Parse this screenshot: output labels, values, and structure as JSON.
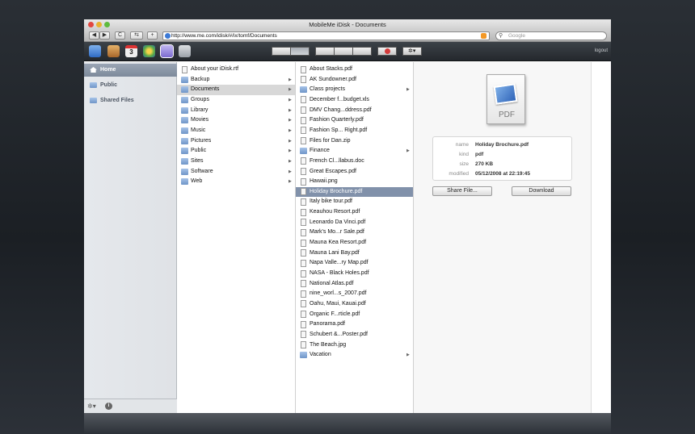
{
  "window": {
    "title": "MobileMe iDisk - Documents"
  },
  "toolbar": {
    "back": "◀",
    "forward": "▶",
    "reload": "C",
    "bookmarks": "⇆",
    "add": "+",
    "url": "http://www.me.com/idisk/#/ix/tomf/Documents",
    "search_placeholder": "Google"
  },
  "appbar": {
    "apps": [
      {
        "name": "mail",
        "color": "#4a86d8"
      },
      {
        "name": "contacts",
        "color": "#c88a3a"
      },
      {
        "name": "calendar",
        "color": "#d9d9d9",
        "label": "3"
      },
      {
        "name": "gallery",
        "color": "#6cae4e"
      },
      {
        "name": "idisk",
        "color": "#8f7fd6"
      },
      {
        "name": "account",
        "color": "#9aa0a7"
      }
    ],
    "logout": "logout"
  },
  "sidebar": {
    "items": [
      {
        "label": "Home",
        "selected": true
      },
      {
        "label": "Public",
        "selected": false
      },
      {
        "label": "Shared Files",
        "selected": false
      }
    ]
  },
  "column1": {
    "items": [
      {
        "label": "About your iDisk.rtf",
        "type": "doc"
      },
      {
        "label": "Backup",
        "type": "folder"
      },
      {
        "label": "Documents",
        "type": "folder",
        "selected": true
      },
      {
        "label": "Groups",
        "type": "folder"
      },
      {
        "label": "Library",
        "type": "folder"
      },
      {
        "label": "Movies",
        "type": "folder"
      },
      {
        "label": "Music",
        "type": "folder"
      },
      {
        "label": "Pictures",
        "type": "folder"
      },
      {
        "label": "Public",
        "type": "folder"
      },
      {
        "label": "Sites",
        "type": "folder"
      },
      {
        "label": "Software",
        "type": "folder"
      },
      {
        "label": "Web",
        "type": "folder"
      }
    ]
  },
  "column2": {
    "items": [
      {
        "label": "About Stacks.pdf",
        "type": "doc"
      },
      {
        "label": "AK Sundowner.pdf",
        "type": "doc"
      },
      {
        "label": "Class projects",
        "type": "folder"
      },
      {
        "label": "December f...budget.xls",
        "type": "doc"
      },
      {
        "label": "DMV Chang...ddress.pdf",
        "type": "doc"
      },
      {
        "label": "Fashion Quarterly.pdf",
        "type": "doc"
      },
      {
        "label": "Fashion Sp... Right.pdf",
        "type": "doc"
      },
      {
        "label": "Files for Dan.zip",
        "type": "doc"
      },
      {
        "label": "Finance",
        "type": "folder"
      },
      {
        "label": "French Cl...llabus.doc",
        "type": "doc"
      },
      {
        "label": "Great Escapes.pdf",
        "type": "doc"
      },
      {
        "label": "Hawaii.png",
        "type": "doc"
      },
      {
        "label": "Holiday Brochure.pdf",
        "type": "doc",
        "selected": true
      },
      {
        "label": "Italy bike tour.pdf",
        "type": "doc"
      },
      {
        "label": "Keauhou Resort.pdf",
        "type": "doc"
      },
      {
        "label": "Leonardo Da Vinci.pdf",
        "type": "doc"
      },
      {
        "label": "Mark's Mo...r Sale.pdf",
        "type": "doc"
      },
      {
        "label": "Mauna Kea Resort.pdf",
        "type": "doc"
      },
      {
        "label": "Mauna Lani Bay.pdf",
        "type": "doc"
      },
      {
        "label": "Napa Valle...ry Map.pdf",
        "type": "doc"
      },
      {
        "label": "NASA - Black Holes.pdf",
        "type": "doc"
      },
      {
        "label": "National Atlas.pdf",
        "type": "doc"
      },
      {
        "label": "nine_worl...s_2007.pdf",
        "type": "doc"
      },
      {
        "label": "Oahu, Maui, Kauai.pdf",
        "type": "doc"
      },
      {
        "label": "Organic F...rticle.pdf",
        "type": "doc"
      },
      {
        "label": "Panorama.pdf",
        "type": "doc"
      },
      {
        "label": "Schubert &...Poster.pdf",
        "type": "doc"
      },
      {
        "label": "The Beach.jpg",
        "type": "doc"
      },
      {
        "label": "Vacation",
        "type": "folder"
      }
    ]
  },
  "preview": {
    "icon_label": "PDF",
    "info": [
      {
        "label": "name",
        "value": "Holiday Brochure.pdf"
      },
      {
        "label": "kind",
        "value": "pdf"
      },
      {
        "label": "size",
        "value": "270 KB"
      },
      {
        "label": "modified",
        "value": "05/12/2008 at 22:19:45"
      }
    ],
    "share_label": "Share File...",
    "download_label": "Download"
  },
  "colors": {
    "selection_blue": "#8191aa",
    "sidebar_selected": "#8795a8"
  }
}
